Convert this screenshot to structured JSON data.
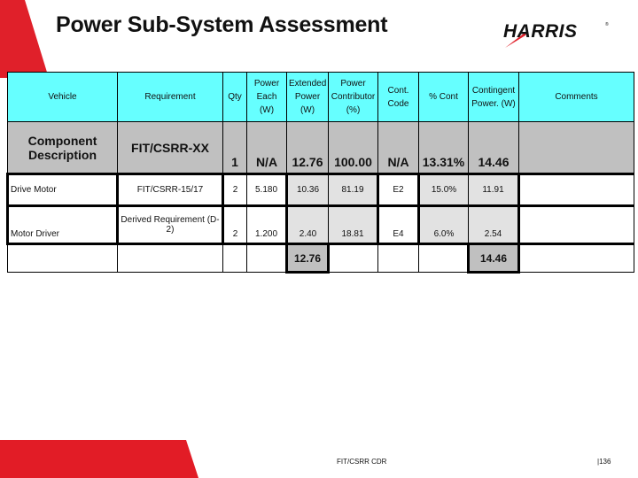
{
  "header": {
    "title": "Power Sub-System Assessment",
    "logo_text": "HARRIS",
    "logo_mark": "®"
  },
  "colors": {
    "accent_red": "#e0202a",
    "header_cyan": "#66ffff",
    "component_gray": "#c0c0c0",
    "calc_gray": "#e2e2e2"
  },
  "table": {
    "columns": [
      "Vehicle",
      "Requirement",
      "Qty",
      "Power Each (W)",
      "Extended Power (W)",
      "Power Contributor (%)",
      "Cont. Code",
      "% Cont",
      "Contingent Power. (W)",
      "Comments"
    ],
    "component_row": {
      "description": "Component Description",
      "requirement": "FIT/CSRR-XX",
      "qty": "1",
      "power_each": "N/A",
      "extended_power": "12.76",
      "power_contributor": "100.00",
      "cont_code": "N/A",
      "pct_cont": "13.31%",
      "contingent_power": "14.46",
      "comments": ""
    },
    "rows": [
      {
        "vehicle": "Drive Motor",
        "requirement": "FIT/CSRR-15/17",
        "qty": "2",
        "power_each": "5.180",
        "extended_power": "10.36",
        "power_contributor": "81.19",
        "cont_code": "E2",
        "pct_cont": "15.0%",
        "contingent_power": "11.91",
        "comments": ""
      },
      {
        "vehicle": "Motor Driver",
        "requirement": "Derived Requirement (D-2)",
        "qty": "2",
        "power_each": "1.200",
        "extended_power": "2.40",
        "power_contributor": "18.81",
        "cont_code": "E4",
        "pct_cont": "6.0%",
        "contingent_power": "2.54",
        "comments": ""
      }
    ],
    "totals": {
      "extended_power": "12.76",
      "contingent_power": "14.46"
    }
  },
  "footer": {
    "doc_label": "FIT/CSRR CDR",
    "page_number": "136"
  }
}
